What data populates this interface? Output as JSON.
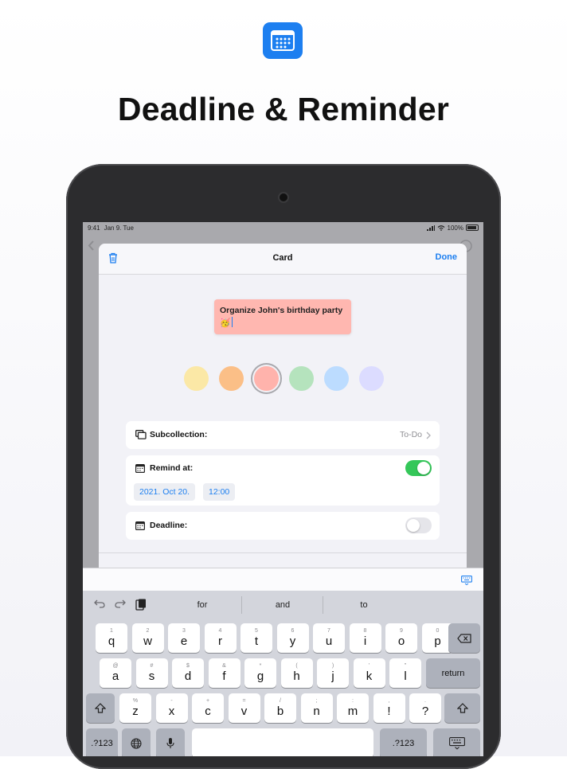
{
  "promo": {
    "icon": "calendar-icon",
    "title": "Deadline & Reminder"
  },
  "status_bar": {
    "time": "9:41",
    "date": "Jan 9. Tue",
    "battery": "100%"
  },
  "card_sheet": {
    "title": "Card",
    "done_label": "Done",
    "note_text": "Organize John's birthday party 🥳",
    "colors": [
      "#fbe8a6",
      "#fbbf87",
      "#ffb3ac",
      "#b5e3bd",
      "#bcdcff",
      "#dcdcff"
    ],
    "selected_color_index": 2,
    "subcollection": {
      "label": "Subcollection:",
      "value": "To-Do"
    },
    "remind": {
      "label": "Remind at:",
      "date": "2021. Oct 20.",
      "time": "12:00",
      "enabled": true
    },
    "deadline": {
      "label": "Deadline:",
      "enabled": false
    }
  },
  "keyboard": {
    "suggestions": [
      "for",
      "and",
      "to"
    ],
    "row1": [
      {
        "main": "q",
        "sub": "1"
      },
      {
        "main": "w",
        "sub": "2"
      },
      {
        "main": "e",
        "sub": "3"
      },
      {
        "main": "r",
        "sub": "4"
      },
      {
        "main": "t",
        "sub": "5"
      },
      {
        "main": "y",
        "sub": "6"
      },
      {
        "main": "u",
        "sub": "7"
      },
      {
        "main": "i",
        "sub": "8"
      },
      {
        "main": "o",
        "sub": "9"
      },
      {
        "main": "p",
        "sub": "0"
      }
    ],
    "row2": [
      {
        "main": "a",
        "sub": "@"
      },
      {
        "main": "s",
        "sub": "#"
      },
      {
        "main": "d",
        "sub": "$"
      },
      {
        "main": "f",
        "sub": "&"
      },
      {
        "main": "g",
        "sub": "*"
      },
      {
        "main": "h",
        "sub": "("
      },
      {
        "main": "j",
        "sub": ")"
      },
      {
        "main": "k",
        "sub": "'"
      },
      {
        "main": "l",
        "sub": "\""
      }
    ],
    "row3": [
      {
        "main": "z",
        "sub": "%"
      },
      {
        "main": "x",
        "sub": "-"
      },
      {
        "main": "c",
        "sub": "+"
      },
      {
        "main": "v",
        "sub": "="
      },
      {
        "main": "b",
        "sub": "/"
      },
      {
        "main": "n",
        "sub": ";"
      },
      {
        "main": "m",
        "sub": ":"
      },
      {
        "main": "!",
        "sub": ","
      },
      {
        "main": "?",
        "sub": "."
      }
    ],
    "return_label": "return",
    "numbers_label": ".?123"
  }
}
